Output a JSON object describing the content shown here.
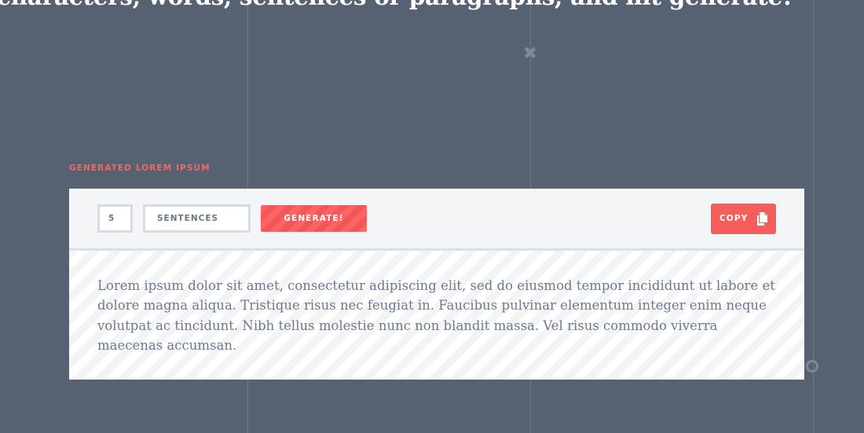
{
  "hero": {
    "headline": "characters, words, sentences or paragraphs, and hit generate!"
  },
  "output_section": {
    "label": "GENERATED LOREM IPSUM"
  },
  "toolbar": {
    "count_value": "5",
    "unit_value": "SENTENCES",
    "generate_label": "GENERATE!",
    "copy_label": "COPY"
  },
  "output": {
    "text": "Lorem ipsum dolor sit amet, consectetur adipiscing elit, sed do eiusmod tempor incididunt ut labore et dolore magna aliqua. Tristique risus nec feugiat in. Faucibus pulvinar elementum integer enim neque volutpat ac tincidunt. Nibh tellus molestie nunc non blandit massa. Vel risus commodo viverra maecenas accumsan."
  },
  "icons": {
    "close": "close-icon",
    "circle": "circle-decoration-icon",
    "copy": "copy-document-icon"
  },
  "colors": {
    "background": "#566172",
    "accent": "#f65e5b",
    "label": "#f06a62",
    "body_text": "#6e798c"
  }
}
